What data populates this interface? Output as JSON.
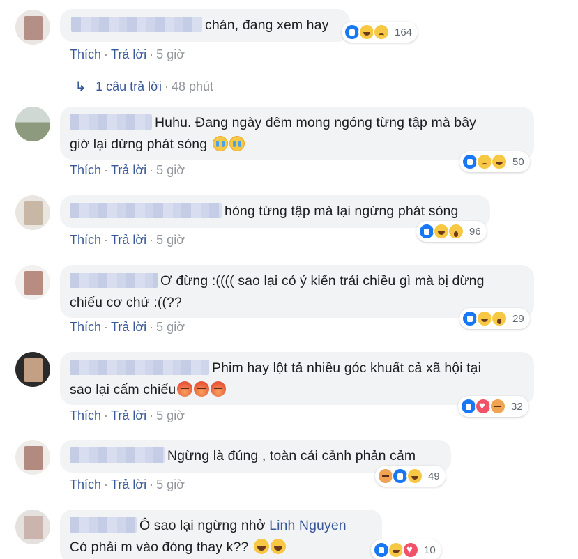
{
  "actions": {
    "like": "Thích",
    "reply": "Trả lời",
    "separator": "·"
  },
  "replies_link": {
    "label": "1 câu trả lời",
    "time": "48 phút"
  },
  "comments": [
    {
      "line1": "chán, đang xem hay",
      "line2": "",
      "time": "5 giờ",
      "reactions": [
        "like",
        "haha",
        "sad"
      ],
      "count": "164"
    },
    {
      "line1": "Huhu. Đang ngày đêm mong ngóng từng tập mà bây",
      "line2": "giờ lại dừng phát sóng",
      "time": "5 giờ",
      "reactions": [
        "like",
        "sad",
        "haha"
      ],
      "count": "50"
    },
    {
      "line1": "hóng từng tập mà lại ngừng phát sóng",
      "line2": "",
      "time": "5 giờ",
      "reactions": [
        "like",
        "haha",
        "wow"
      ],
      "count": "96"
    },
    {
      "line1": "Ơ đừng :(((( sao lại có ý kiến trái chiều gì mà bị dừng",
      "line2": "chiếu cơ chứ :((??",
      "time": "5 giờ",
      "reactions": [
        "like",
        "haha",
        "wow"
      ],
      "count": "29"
    },
    {
      "line1": "Phim hay lột tả nhiều góc khuất cả xã hội tại",
      "line2": "sao lại cấm chiếu",
      "time": "5 giờ",
      "reactions": [
        "like",
        "love",
        "angry"
      ],
      "count": "32"
    },
    {
      "line1": "Ngừng là đúng , toàn cái cảnh phản cảm",
      "line2": "",
      "time": "5 giờ",
      "reactions": [
        "angry",
        "like",
        "haha"
      ],
      "count": "49"
    },
    {
      "line1": "Ô sao lại ngừng nhở",
      "tag": "Linh Nguyen",
      "line2": "Có phải m vào đóng thay k??",
      "time": "",
      "reactions": [
        "like",
        "haha",
        "love"
      ],
      "count": "10"
    }
  ]
}
